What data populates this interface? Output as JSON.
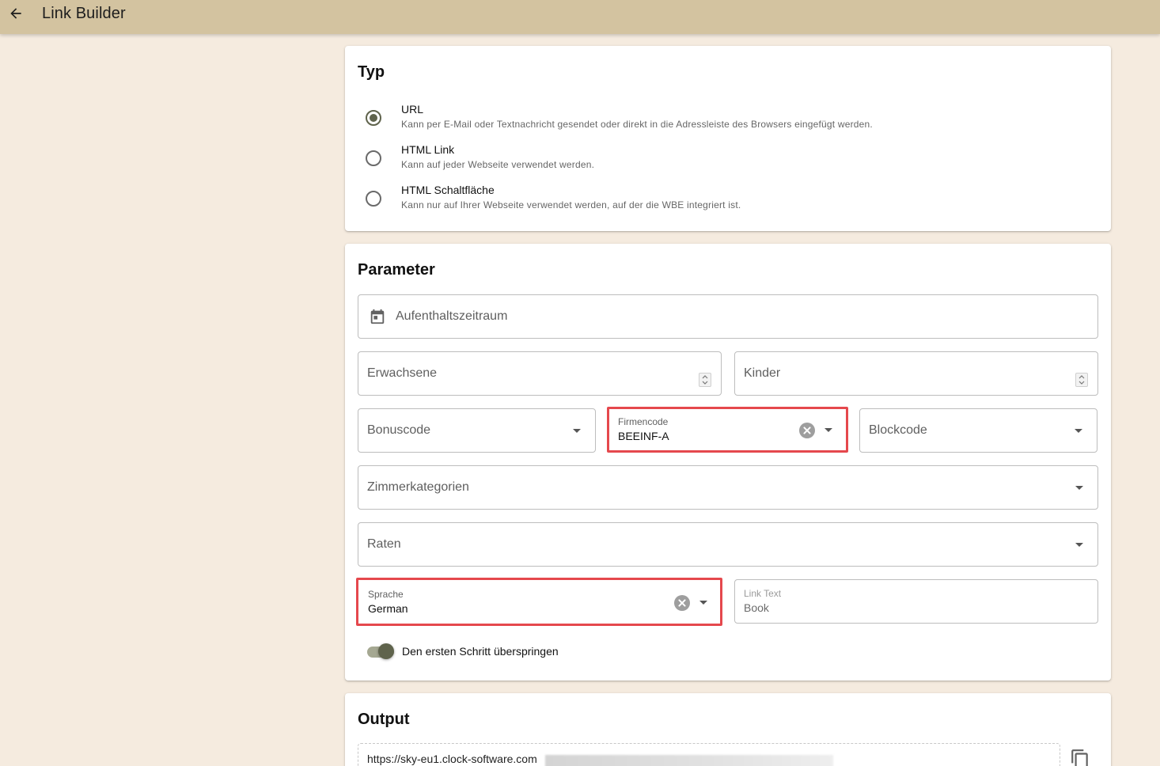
{
  "app": {
    "title": "Link Builder"
  },
  "typ": {
    "title": "Typ",
    "options": [
      {
        "label": "URL",
        "description": "Kann per E-Mail oder Textnachricht gesendet oder direkt in die Adressleiste des Browsers eingefügt werden.",
        "checked": true
      },
      {
        "label": "HTML Link",
        "description": "Kann auf jeder Webseite verwendet werden.",
        "checked": false
      },
      {
        "label": "HTML Schaltfläche",
        "description": "Kann nur auf Ihrer Webseite verwendet werden, auf der die WBE integriert ist.",
        "checked": false
      }
    ]
  },
  "parameter": {
    "title": "Parameter",
    "stay_period": {
      "placeholder": "Aufenthaltszeitraum"
    },
    "adults": {
      "placeholder": "Erwachsene"
    },
    "children": {
      "placeholder": "Kinder"
    },
    "bonus_code": {
      "placeholder": "Bonuscode"
    },
    "company_code": {
      "label": "Firmencode",
      "value": "BEEINF-A"
    },
    "block_code": {
      "placeholder": "Blockcode"
    },
    "room_categories": {
      "placeholder": "Zimmerkategorien"
    },
    "rates": {
      "placeholder": "Raten"
    },
    "language": {
      "label": "Sprache",
      "value": "German"
    },
    "link_text": {
      "label": "Link Text",
      "value": "Book"
    },
    "skip_first_step": {
      "label": "Den ersten Schritt überspringen",
      "enabled": true
    }
  },
  "output": {
    "title": "Output",
    "url_prefix": "https://sky-eu1.clock-software.com"
  },
  "colors": {
    "topbar": "#d3c3a0",
    "background": "#f5ebdf",
    "accent": "#5f634c",
    "highlight": "#e5484d"
  }
}
